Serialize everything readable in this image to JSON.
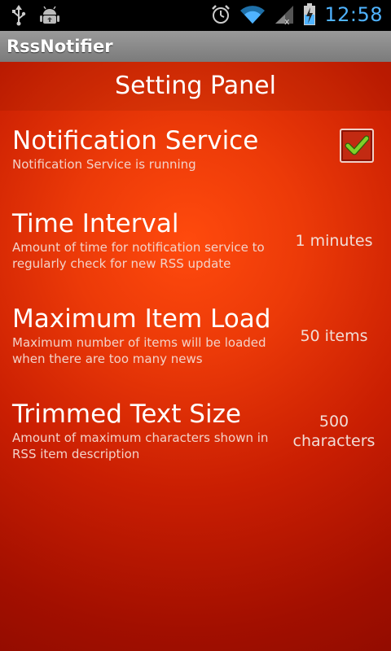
{
  "status_bar": {
    "time": "12:58",
    "icons": [
      "usb-icon",
      "android-debug-icon",
      "alarm-icon",
      "wifi-icon",
      "signal-icon",
      "battery-charging-icon"
    ]
  },
  "app": {
    "title": "RssNotifier"
  },
  "panel": {
    "header": "Setting Panel"
  },
  "settings": [
    {
      "title": "Notification Service",
      "description": "Notification Service is running",
      "checked": true
    },
    {
      "title": "Time Interval",
      "description": "Amount of time for notification service to regularly check for new RSS update",
      "value": "1 minutes"
    },
    {
      "title": "Maximum Item Load",
      "description": "Maximum number of items will be loaded when there are too many news",
      "value": "50 items"
    },
    {
      "title": "Trimmed Text Size",
      "description": "Amount of maximum characters shown in RSS item description",
      "value_line1": "500",
      "value_line2": "characters"
    }
  ],
  "colors": {
    "status_time": "#4fb3ff",
    "check_green": "#7fd12a",
    "background_center": "#ff4a0d",
    "background_edge": "#930c00"
  }
}
